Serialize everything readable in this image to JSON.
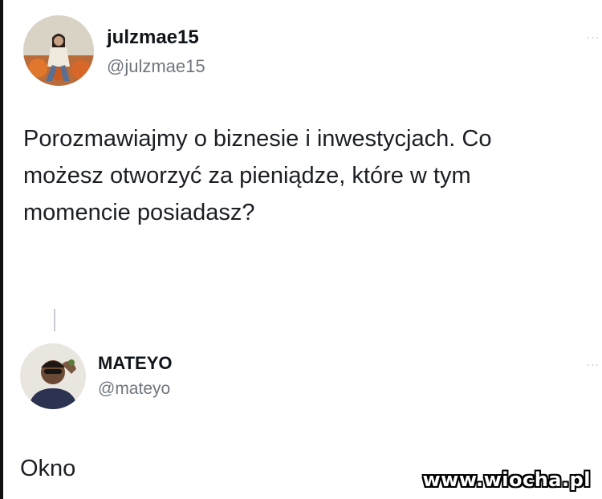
{
  "tweets": [
    {
      "name": "julzmae15",
      "handle": "@julzmae15",
      "more": "...",
      "text": "Porozmawiajmy o biznesie i inwestycjach. Co możesz otworzyć za pieniądze, które w tym momencie posiadasz?"
    },
    {
      "name": "MATEYO",
      "handle": "@mateyo",
      "more": "...",
      "text": "Okno"
    }
  ],
  "watermark": "www.wiocha.pl",
  "icons": {
    "more": "more-options-icon"
  }
}
